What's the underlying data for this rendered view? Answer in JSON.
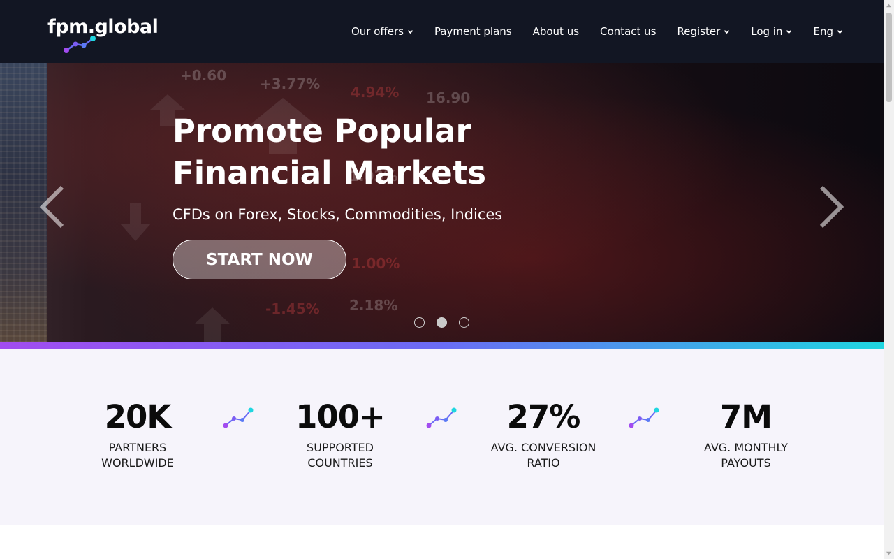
{
  "header": {
    "logo_text": "fpm.global",
    "nav": [
      {
        "label": "Our offers",
        "has_dropdown": true
      },
      {
        "label": "Payment plans",
        "has_dropdown": false
      },
      {
        "label": "About us",
        "has_dropdown": false
      },
      {
        "label": "Contact us",
        "has_dropdown": false
      },
      {
        "label": "Register",
        "has_dropdown": true
      },
      {
        "label": "Log in",
        "has_dropdown": true
      },
      {
        "label": "Eng",
        "has_dropdown": true
      }
    ]
  },
  "hero": {
    "title": "Promote Popular Financial Markets",
    "subtitle": "CFDs on Forex, Stocks, Commodities, Indices",
    "cta_label": "START NOW",
    "active_slide": 2,
    "slide_count": 3,
    "background_tickers": [
      "+0.60",
      "+3.77%",
      "4.94%",
      "16.90",
      "1.03%",
      "1.00%",
      "2.18%",
      "-1.45%"
    ]
  },
  "stats": [
    {
      "value": "20K",
      "label": "PARTNERS\nWORLDWIDE"
    },
    {
      "value": "100+",
      "label": "SUPPORTED\nCOUNTRIES"
    },
    {
      "value": "27%",
      "label": "AVG. CONVERSION\nRATIO"
    },
    {
      "value": "7M",
      "label": "AVG. MONTHLY\nPAYOUTS"
    }
  ],
  "colors": {
    "header_bg": "#121623",
    "accent_purple": "#a24cf0",
    "accent_blue": "#6a6cf5",
    "accent_cyan": "#1fd6e0",
    "stats_bg": "#f6f4fb"
  }
}
